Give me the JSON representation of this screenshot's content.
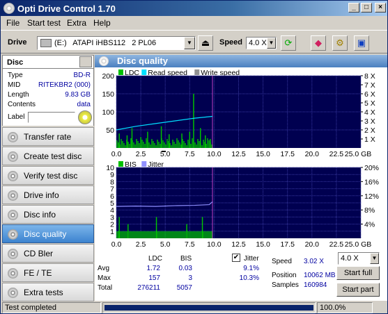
{
  "window": {
    "title": "Opti Drive Control 1.70",
    "min": "_",
    "max": "□",
    "close": "×"
  },
  "menu": [
    "File",
    "Start test",
    "Extra",
    "Help"
  ],
  "toolbar": {
    "drive_label": "Drive",
    "drive_value": "(E:)   ATAPI iHBS112   2 PL06",
    "speed_label": "Speed",
    "speed_value": "4.0 X"
  },
  "disc": {
    "header": "Disc",
    "rows": [
      {
        "k": "Type",
        "v": "BD-R"
      },
      {
        "k": "MID",
        "v": "RITEKBR2 (000)"
      },
      {
        "k": "Length",
        "v": "9.83 GB"
      },
      {
        "k": "Contents",
        "v": "data"
      }
    ],
    "label_key": "Label"
  },
  "nav": [
    "Transfer rate",
    "Create test disc",
    "Verify test disc",
    "Drive info",
    "Disc info",
    "Disc quality",
    "CD Bler",
    "FE / TE",
    "Extra tests"
  ],
  "nav_active": 5,
  "panel_title": "Disc quality",
  "chart_data": [
    {
      "type": "bar",
      "legend": [
        "LDC",
        "Read speed",
        "Write speed"
      ],
      "colors": {
        "LDC": "#00c000",
        "Read speed": "#00e0ff",
        "Write speed": "#909090",
        "bg": "#000050",
        "grid": "#3a3aa0"
      },
      "x_ticks": [
        "0.0",
        "2.5",
        "5.0",
        "7.5",
        "10.0",
        "12.5",
        "15.0",
        "17.5",
        "20.0",
        "22.5",
        "25.0 GB"
      ],
      "y_ticks": [
        "200",
        "150",
        "100",
        "50"
      ],
      "y2_ticks": [
        "8 X",
        "7 X",
        "6 X",
        "5 X",
        "4 X",
        "3 X",
        "2 X",
        "1 X"
      ],
      "xlim": [
        0,
        25
      ],
      "ylim": [
        0,
        200
      ],
      "y2lim": [
        0,
        8
      ],
      "ldc_bars": [
        [
          0.3,
          40
        ],
        [
          1.1,
          35
        ],
        [
          1.6,
          55
        ],
        [
          2.5,
          30
        ],
        [
          3.2,
          45
        ],
        [
          4.6,
          60
        ],
        [
          5.4,
          38
        ],
        [
          6.7,
          40
        ],
        [
          7.5,
          45
        ],
        [
          7.9,
          150
        ],
        [
          8.6,
          55
        ],
        [
          9.1,
          35
        ],
        [
          9.6,
          25
        ]
      ],
      "read_speed": [
        [
          0,
          2.0
        ],
        [
          2,
          2.4
        ],
        [
          4,
          2.7
        ],
        [
          6,
          3.0
        ],
        [
          8,
          3.3
        ],
        [
          9.83,
          3.5
        ]
      ]
    },
    {
      "type": "bar",
      "legend": [
        "BIS",
        "Jitter"
      ],
      "colors": {
        "BIS": "#00c000",
        "Jitter": "#9090ff",
        "bg": "#000050",
        "grid": "#3a3aa0"
      },
      "x_ticks": [
        "0.0",
        "2.5",
        "5.0",
        "7.5",
        "10.0",
        "12.5",
        "15.0",
        "17.5",
        "20.0",
        "22.5",
        "25.0 GB"
      ],
      "y_ticks": [
        "10",
        "9",
        "8",
        "7",
        "6",
        "5",
        "4",
        "3",
        "2",
        "1"
      ],
      "y2_ticks": [
        "20%",
        "16%",
        "12%",
        "8%",
        "4%"
      ],
      "xlim": [
        0,
        25
      ],
      "ylim": [
        0,
        10
      ],
      "y2lim": [
        0,
        20
      ],
      "bis_level": 1,
      "bis_spikes": [
        [
          0.3,
          3
        ],
        [
          1.2,
          2
        ],
        [
          4.1,
          3
        ],
        [
          7.2,
          2
        ],
        [
          8.8,
          3
        ]
      ],
      "jitter": [
        [
          0,
          9.0
        ],
        [
          2,
          9.1
        ],
        [
          4,
          9.0
        ],
        [
          6,
          9.2
        ],
        [
          8,
          9.3
        ],
        [
          9.5,
          9.5
        ],
        [
          9.83,
          10.3
        ]
      ]
    }
  ],
  "stats": {
    "cols": [
      "LDC",
      "BIS"
    ],
    "rows": [
      {
        "k": "Avg",
        "ldc": "1.72",
        "bis": "0.03",
        "jit": "9.1%"
      },
      {
        "k": "Max",
        "ldc": "157",
        "bis": "3",
        "jit": "10.3%"
      },
      {
        "k": "Total",
        "ldc": "276211",
        "bis": "5057",
        "jit": ""
      }
    ],
    "jitter_label": "Jitter",
    "jitter_checked": true,
    "speed_label": "Speed",
    "speed_value": "3.02 X",
    "speed_combo": "4.0 X",
    "position_label": "Position",
    "position_value": "10062 MB",
    "samples_label": "Samples",
    "samples_value": "160984",
    "start_full": "Start full",
    "start_part": "Start part"
  },
  "status": {
    "text": "Test completed",
    "progress": 1.0,
    "percent": "100.0%"
  }
}
